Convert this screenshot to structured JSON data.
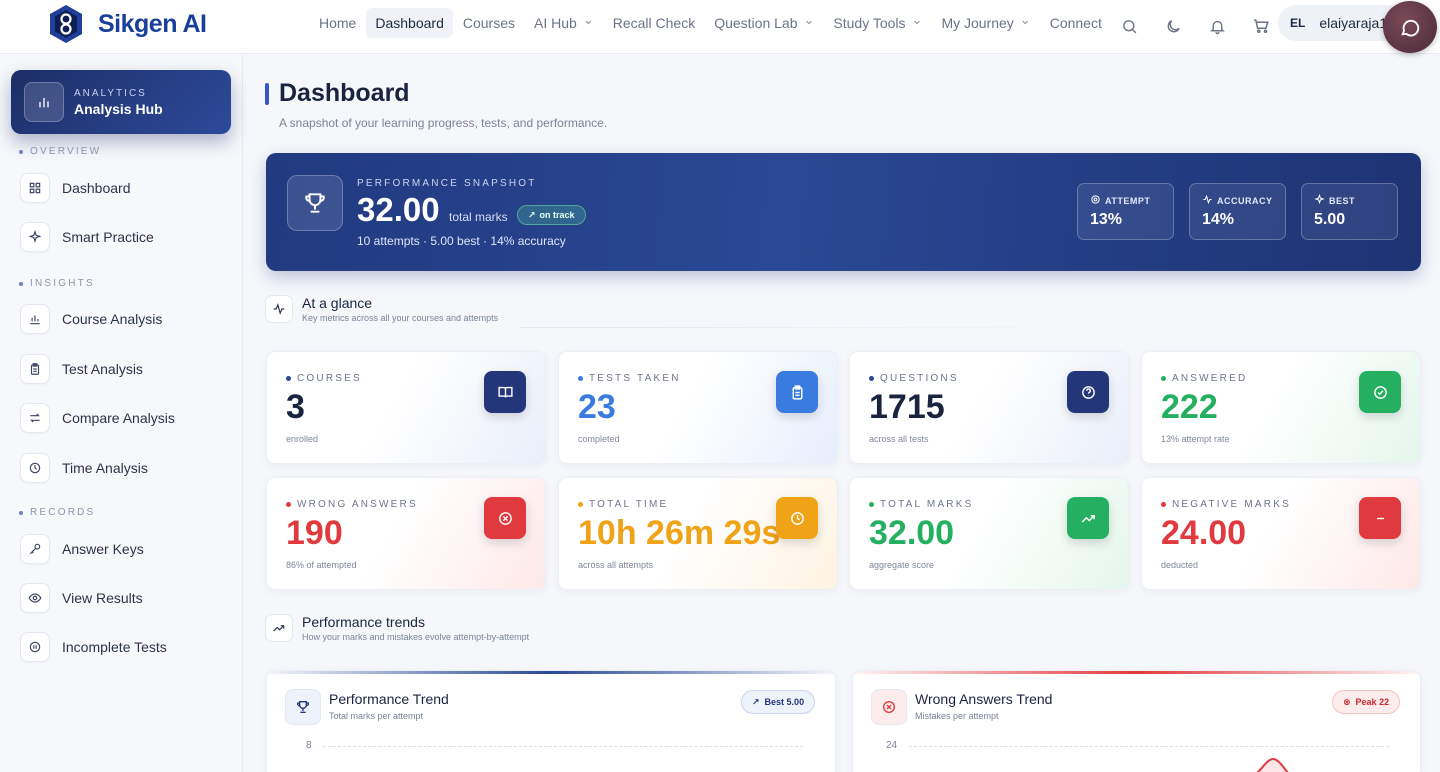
{
  "brand": {
    "name": "Sikgen AI"
  },
  "nav": {
    "items": [
      {
        "label": "Home",
        "dropdown": false,
        "active": false
      },
      {
        "label": "Dashboard",
        "dropdown": false,
        "active": true
      },
      {
        "label": "Courses",
        "dropdown": false,
        "active": false
      },
      {
        "label": "AI Hub",
        "dropdown": true,
        "active": false
      },
      {
        "label": "Recall Check",
        "dropdown": false,
        "active": false
      },
      {
        "label": "Question Lab",
        "dropdown": true,
        "active": false
      },
      {
        "label": "Study Tools",
        "dropdown": true,
        "active": false
      },
      {
        "label": "My Journey",
        "dropdown": true,
        "active": false
      },
      {
        "label": "Connect",
        "dropdown": false,
        "active": false
      }
    ],
    "icons": [
      "search-icon",
      "moon-icon",
      "bell-icon",
      "cart-icon"
    ]
  },
  "user": {
    "initials": "EL",
    "name": "elaiyaraja1"
  },
  "sidebar": {
    "hub": {
      "label": "ANALYTICS",
      "title": "Analysis Hub"
    },
    "sections": [
      {
        "label": "OVERVIEW",
        "items": [
          {
            "label": "Dashboard",
            "icon": "grid-icon"
          },
          {
            "label": "Smart Practice",
            "icon": "sparkle-icon"
          }
        ]
      },
      {
        "label": "INSIGHTS",
        "items": [
          {
            "label": "Course Analysis",
            "icon": "bar-chart-icon"
          },
          {
            "label": "Test Analysis",
            "icon": "clipboard-icon"
          },
          {
            "label": "Compare Analysis",
            "icon": "arrows-icon"
          },
          {
            "label": "Time Analysis",
            "icon": "clock-icon"
          }
        ]
      },
      {
        "label": "RECORDS",
        "items": [
          {
            "label": "Answer Keys",
            "icon": "key-icon"
          },
          {
            "label": "View Results",
            "icon": "eye-icon"
          },
          {
            "label": "Incomplete Tests",
            "icon": "pause-icon"
          }
        ]
      }
    ]
  },
  "page": {
    "title": "Dashboard",
    "subtitle": "A snapshot of your learning progress, tests, and performance."
  },
  "hero": {
    "label": "PERFORMANCE SNAPSHOT",
    "value": "32.00",
    "unit": "total marks",
    "badge": "on track",
    "meta": "10 attempts · 5.00 best · 14% accuracy",
    "stats": [
      {
        "label": "ATTEMPT",
        "value": "13%",
        "icon": "target-icon"
      },
      {
        "label": "ACCURACY",
        "value": "14%",
        "icon": "activity-icon"
      },
      {
        "label": "BEST",
        "value": "5.00",
        "icon": "sparkle-icon"
      }
    ]
  },
  "glance": {
    "title": "At a glance",
    "subtitle": "Key metrics across all your courses and attempts"
  },
  "metrics": [
    {
      "label": "COURSES",
      "value": "3",
      "sub": "enrolled",
      "color": "#1a2440",
      "dot": "#2a4894",
      "icon": "book-icon",
      "icon_bg": "#23367a",
      "tint": "#e9eef9"
    },
    {
      "label": "TESTS TAKEN",
      "value": "23",
      "sub": "completed",
      "color": "#3a7be0",
      "dot": "#3a7be0",
      "icon": "clipboard-icon",
      "icon_bg": "#3a7be0",
      "tint": "#e6eefc"
    },
    {
      "label": "QUESTIONS",
      "value": "1715",
      "sub": "across all tests",
      "color": "#1a2440",
      "dot": "#2a4894",
      "icon": "question-icon",
      "icon_bg": "#23367a",
      "tint": "#e9eef9"
    },
    {
      "label": "ANSWERED",
      "value": "222",
      "sub": "13% attempt rate",
      "color": "#25b061",
      "dot": "#25b061",
      "icon": "check-circle-icon",
      "icon_bg": "#25b061",
      "tint": "#e4f6ec"
    },
    {
      "label": "WRONG ANSWERS",
      "value": "190",
      "sub": "86% of attempted",
      "color": "#e0393e",
      "dot": "#e0393e",
      "icon": "x-circle-icon",
      "icon_bg": "#e0393e",
      "tint": "#fde8e8"
    },
    {
      "label": "TOTAL TIME",
      "value": "10h 26m 29s",
      "sub": "across all attempts",
      "color": "#f0a316",
      "dot": "#f0a316",
      "icon": "clock-icon",
      "icon_bg": "#f0a316",
      "tint": "#fdf3e1"
    },
    {
      "label": "TOTAL MARKS",
      "value": "32.00",
      "sub": "aggregate score",
      "color": "#25b061",
      "dot": "#25b061",
      "icon": "trend-up-icon",
      "icon_bg": "#25b061",
      "tint": "#e4f6ec"
    },
    {
      "label": "NEGATIVE MARKS",
      "value": "24.00",
      "sub": "deducted",
      "color": "#e0393e",
      "dot": "#e0393e",
      "icon": "minus-icon",
      "icon_bg": "#e0393e",
      "tint": "#fde8e8"
    }
  ],
  "trends": {
    "title": "Performance trends",
    "subtitle": "How your marks and mistakes evolve attempt-by-attempt"
  },
  "charts": [
    {
      "title": "Performance Trend",
      "subtitle": "Total marks per attempt",
      "badge": "Best 5.00",
      "tick": "8",
      "icon": "trophy-icon"
    },
    {
      "title": "Wrong Answers Trend",
      "subtitle": "Mistakes per attempt",
      "badge": "Peak 22",
      "tick": "24",
      "icon": "x-circle-icon"
    }
  ],
  "colors": {
    "primary": "#2a4894",
    "success": "#25b061",
    "danger": "#e0393e",
    "warning": "#f0a316",
    "info": "#3a7be0"
  }
}
